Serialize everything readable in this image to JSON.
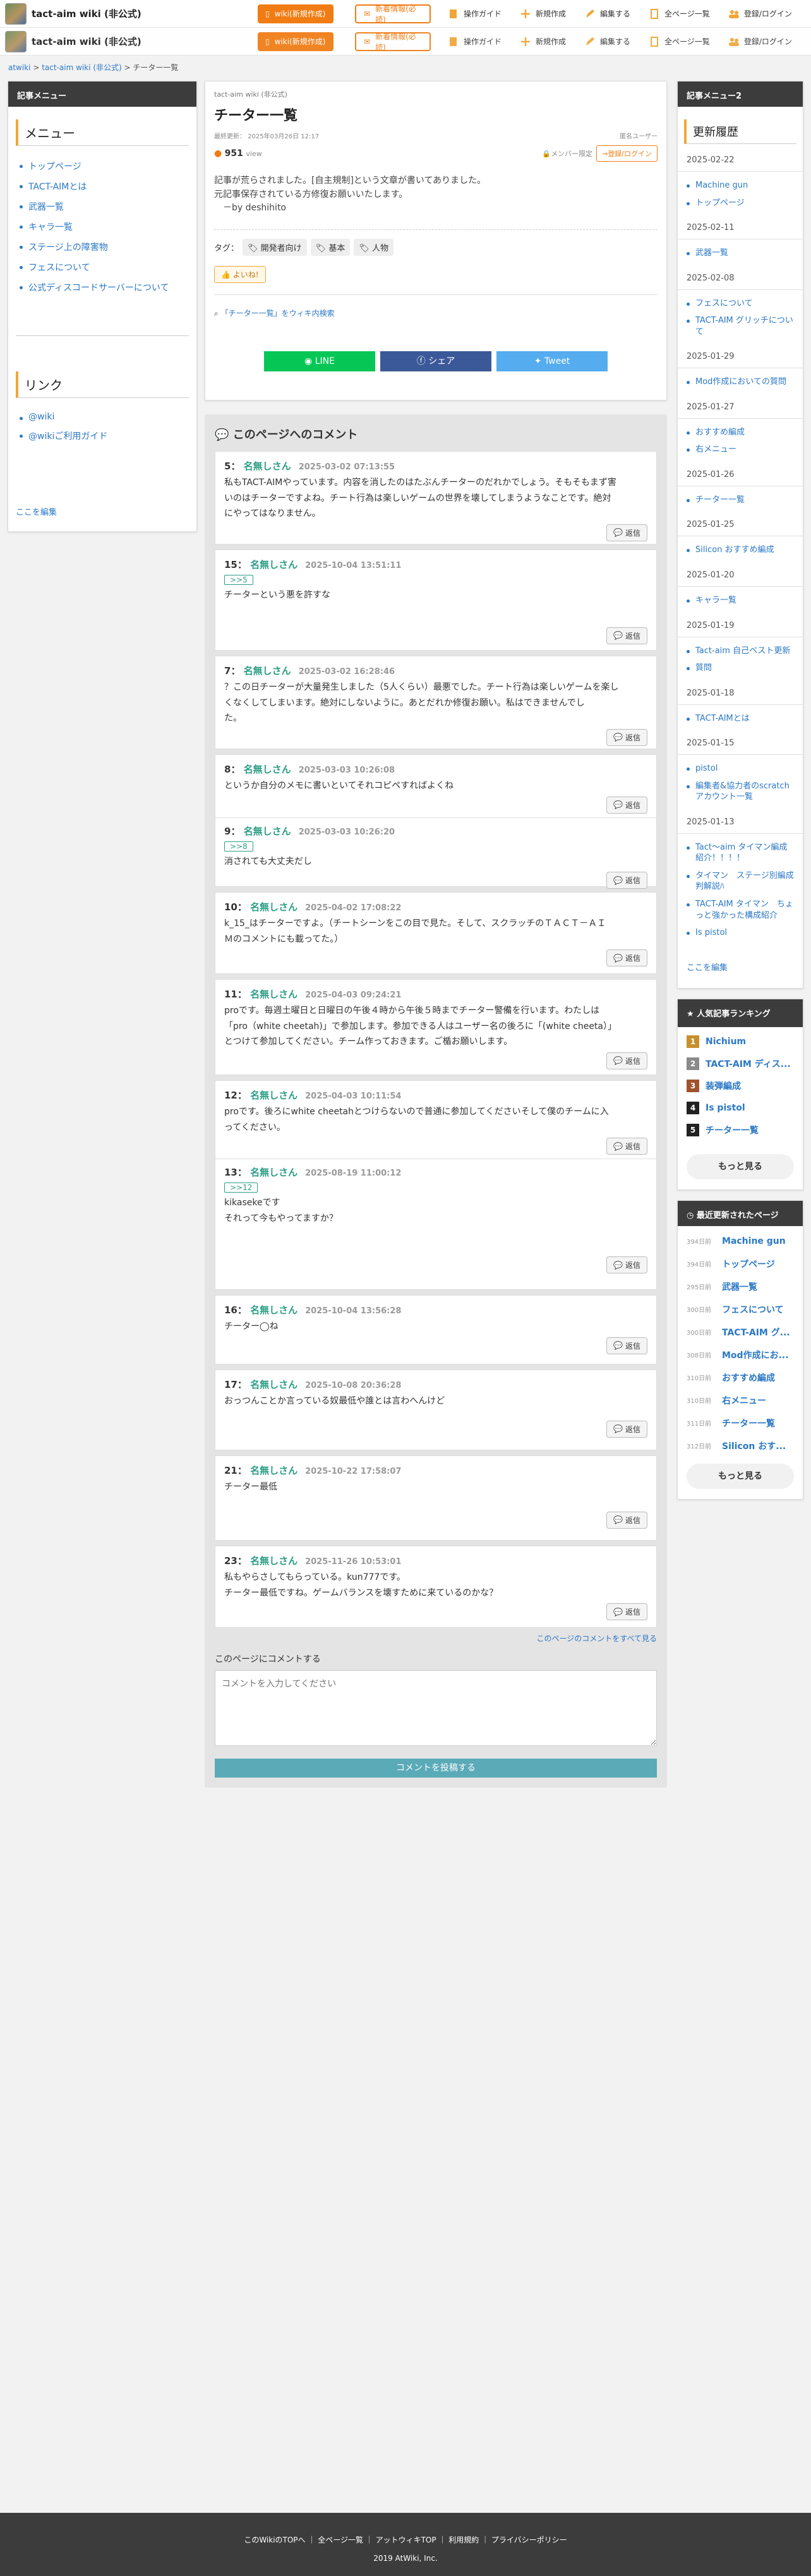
{
  "header": {
    "site_name": "tact-aim wiki (非公式)",
    "btn_create": "wiki(新規作成)",
    "btn_register": "新着情報(必読)",
    "nav": [
      "操作ガイド",
      "新規作成",
      "編集する",
      "全ページ一覧",
      "登録/ログイン"
    ]
  },
  "breadcrumb": [
    "atwiki",
    "tact-aim wiki (非公式)",
    "チーター一覧"
  ],
  "left": {
    "head": "記事メニュー",
    "menu_title": "メニュー",
    "menu": [
      "トップページ",
      "TACT-AIMとは",
      "武器一覧",
      "キャラ一覧",
      "ステージ上の障害物",
      "フェスについて",
      "公式ディスコードサーバーについて"
    ],
    "link_title": "リンク",
    "links": [
      "@wiki",
      "@wikiご利用ガイド"
    ],
    "edit": "ここを編集"
  },
  "article": {
    "site": "tact-aim wiki (非公式)",
    "title": "チーター一覧",
    "updated_label": "最終更新：",
    "updated": "2025年03月26日 12:17",
    "author": "匿名ユーザー",
    "views": "951",
    "views_unit": "view",
    "member_only": "メンバー限定",
    "login": "登録/ログイン",
    "body": [
      "記事が荒らされました。[自主規制]という文章が書いてありました。",
      "元記事保存されている方修復お願いいたします。",
      "　－by deshihito"
    ],
    "tags_label": "タグ：",
    "tags": [
      "開発者向け",
      "基本",
      "人物"
    ],
    "like": "よいね!",
    "search_link": "「チーター一覧」をウィキ内検索",
    "share": [
      "LINE",
      "シェア",
      "Tweet"
    ]
  },
  "comments": {
    "title": "このページへのコメント",
    "reply": "返信",
    "items": [
      {
        "no": "5",
        "name": "名無しさん",
        "date": "2025-03-02 07:13:55",
        "anchor": "",
        "text": [
          "私もTACT-AIMやっています。内容を消したのはたぶんチーターのだれかでしょう。そもそもまず害",
          "いのはチーターですよね。チート行為は楽しいゲームの世界を壊してしまうようなことです。絶対",
          "にやってはなりません。"
        ]
      },
      {
        "no": "15",
        "name": "名無しさん",
        "date": "2025-10-04 13:51:11",
        "anchor": ">>5",
        "text": [
          "チーターという悪を許すな"
        ]
      },
      {
        "no": "7",
        "name": "名無しさん",
        "date": "2025-03-02 16:28:46",
        "anchor": "",
        "text": [
          "？この日チーターが大量発生しました（5人くらい）最悪でした。チート行為は楽しいゲームを楽し",
          "くなくしてしまいます。絶対にしないように。あとだれか修復お願い。私はできませんでし",
          "た。"
        ]
      },
      {
        "no": "8",
        "name": "名無しさん",
        "date": "2025-03-03 10:26:08",
        "anchor": "",
        "text": [
          "というか自分のメモに書いといてそれコピペすればよくね"
        ]
      },
      {
        "no": "9",
        "name": "名無しさん",
        "date": "2025-03-03 10:26:20",
        "anchor": ">>8",
        "text": [
          "消されても大丈夫だし"
        ]
      },
      {
        "no": "10",
        "name": "名無しさん",
        "date": "2025-04-02 17:08:22",
        "anchor": "",
        "text": [
          "k_15_はチーターですよ。（チートシーンをこの目で見た。そして、スクラッチのＴＡＣＴ－ＡＩ",
          "Ｍのコメントにも載ってた。）"
        ]
      },
      {
        "no": "11",
        "name": "名無しさん",
        "date": "2025-04-03 09:24:21",
        "anchor": "",
        "text": [
          "proです。毎週土曜日と日曜日の午後４時から午後５時までチーター警備を行います。わたしは",
          "「pro（white cheetah)」で参加します。参加できる人はユーザー名の後ろに「(white cheeta）」",
          "とつけて参加してください。チーム作っておきます。ご楯お願いします。"
        ]
      },
      {
        "no": "12",
        "name": "名無しさん",
        "date": "2025-04-03 10:11:54",
        "anchor": "",
        "text": [
          "proです。後ろにwhite cheetahとつけらないので普通に参加してくださいそして僕のチームに入",
          "ってください。"
        ]
      },
      {
        "no": "13",
        "name": "名無しさん",
        "date": "2025-08-19 11:00:12",
        "anchor": ">>12",
        "text": [
          "kikasekeです",
          "それって今もやってますか？"
        ]
      },
      {
        "no": "16",
        "name": "名無しさん",
        "date": "2025-10-04 13:56:28",
        "anchor": "",
        "text": [
          "チーター◯ね"
        ]
      },
      {
        "no": "17",
        "name": "名無しさん",
        "date": "2025-10-08 20:36:28",
        "anchor": "",
        "text": [
          "おっつんことか言っている奴最低や誰とは言わへんけど"
        ]
      },
      {
        "no": "21",
        "name": "名無しさん",
        "date": "2025-10-22 17:58:07",
        "anchor": "",
        "text": [
          "チーター最低"
        ]
      },
      {
        "no": "23",
        "name": "名無しさん",
        "date": "2025-11-26 10:53:01",
        "anchor": "",
        "text": [
          "私もやらさしてもらっている。kun777です。",
          "チーター最低ですね。ゲームバランスを壊すために来ているのかな？"
        ]
      }
    ],
    "all_link": "このページのコメントをすべて見る",
    "form_label": "このページにコメントする",
    "placeholder": "コメントを入力してください",
    "submit": "コメントを投稿する"
  },
  "right": {
    "head": "記事メニュー2",
    "title": "更新履歴",
    "groups": [
      {
        "date": "2025-02-22",
        "items": [
          "Machine gun",
          "トップページ"
        ]
      },
      {
        "date": "2025-02-11",
        "items": [
          "武器一覧"
        ]
      },
      {
        "date": "2025-02-08",
        "items": [
          "フェスについて",
          "TACT-AIM グリッチについて"
        ]
      },
      {
        "date": "2025-01-29",
        "items": [
          "Mod作成においての質問"
        ]
      },
      {
        "date": "2025-01-27",
        "items": [
          "おすすめ編成",
          "右メニュー"
        ]
      },
      {
        "date": "2025-01-26",
        "items": [
          "チーター一覧"
        ]
      },
      {
        "date": "2025-01-25",
        "items": [
          "Silicon おすすめ編成"
        ]
      },
      {
        "date": "2025-01-20",
        "items": [
          "キャラ一覧"
        ]
      },
      {
        "date": "2025-01-19",
        "items": [
          "Tact-aim 自己ベスト更新",
          "質問"
        ]
      },
      {
        "date": "2025-01-18",
        "items": [
          "TACT-AIMとは"
        ]
      },
      {
        "date": "2025-01-15",
        "items": [
          "pistol",
          "編集者&協力者のscratchアカウント一覧"
        ]
      },
      {
        "date": "2025-01-13",
        "items": [
          "Tact～aim タイマン編成紹介！！！！",
          "タイマン　ステージ別編成判解説ﾊ",
          "TACT-AIM タイマン　ちょっと強かった構成紹介",
          "Is pistol"
        ]
      }
    ],
    "edit": "ここを編集",
    "ranking_title": "人気記事ランキング",
    "ranking": [
      "Nichium",
      "TACT-AIM ディス...",
      "装弾編成",
      "Is pistol",
      "チーター一覧"
    ],
    "ranking_colors": [
      "#c8902c",
      "#8a8a8a",
      "#a0522d",
      "#222222",
      "#222222"
    ],
    "more": "もっと見る",
    "recent_title": "最近更新されたページ",
    "recent": [
      [
        "394日前",
        "Machine gun"
      ],
      [
        "394日前",
        "トップページ"
      ],
      [
        "295日前",
        "武器一覧"
      ],
      [
        "300日前",
        "フェスについて"
      ],
      [
        "300日前",
        "TACT-AIM グ..."
      ],
      [
        "308日前",
        "Mod作成にお..."
      ],
      [
        "310日前",
        "おすすめ編成"
      ],
      [
        "310日前",
        "右メニュー"
      ],
      [
        "311日前",
        "チーター一覧"
      ],
      [
        "312日前",
        "Silicon おす..."
      ]
    ]
  },
  "footer": {
    "links": [
      "このWikiのTOPへ",
      "全ページ一覧",
      "アットウィキTOP",
      "利用規約",
      "プライバシーポリシー"
    ],
    "copyright": "2019 AtWiki, Inc."
  }
}
